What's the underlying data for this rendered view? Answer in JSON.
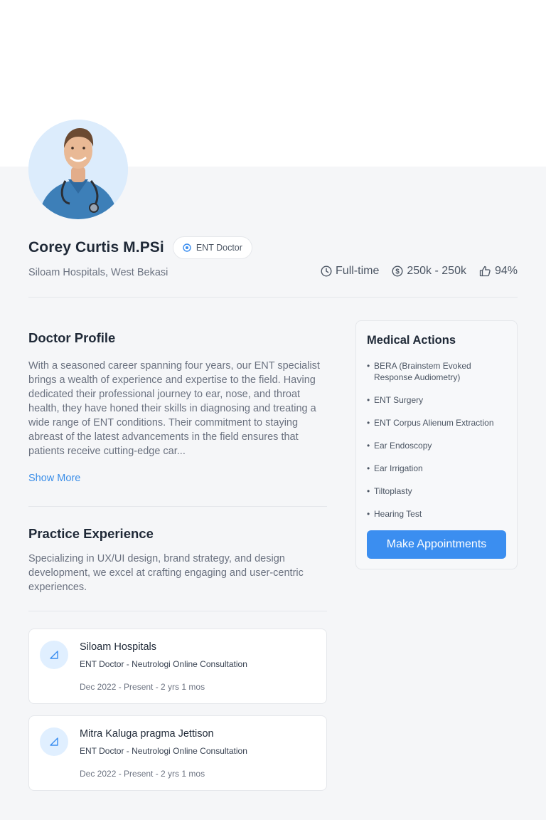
{
  "doctor": {
    "name": "Corey Curtis M.PSi",
    "badge": "ENT Doctor",
    "location": "Siloam Hospitals, West Bekasi"
  },
  "stats": {
    "employment": "Full-time",
    "fee": "250k - 250k",
    "rating": "94%"
  },
  "profile": {
    "title": "Doctor Profile",
    "text": "With a seasoned career spanning four years, our ENT specialist brings a wealth of experience and expertise to the field. Having dedicated their professional journey to ear, nose, and throat health, they have honed their skills in diagnosing and treating a wide range of ENT conditions. Their commitment to staying abreast of the latest advancements in the field ensures that patients receive cutting-edge car...",
    "show_more": "Show More"
  },
  "experience": {
    "title": "Practice Experience",
    "text": "Specializing in UX/UI design, brand strategy, and design development, we excel at crafting engaging and user-centric experiences.",
    "items": [
      {
        "title": "Siloam Hospitals",
        "role": "ENT Doctor - Neutrologi Online Consultation",
        "dates": "Dec 2022 - Present  - 2 yrs 1 mos"
      },
      {
        "title": "Mitra Kaluga pragma Jettison",
        "role": "ENT Doctor - Neutrologi Online Consultation",
        "dates": "Dec 2022 - Present  - 2 yrs 1 mos"
      }
    ]
  },
  "medical_actions": {
    "title": "Medical Actions",
    "items": [
      "BERA (Brainstem Evoked Response Audiometry)",
      "ENT Surgery",
      "ENT Corpus Alienum Extraction",
      "Ear Endoscopy",
      "Ear Irrigation",
      "Tiltoplasty",
      "Hearing Test"
    ],
    "button": "Make Appointments"
  },
  "colors": {
    "accent": "#3b8ef0",
    "link": "#3b8ee8",
    "page_bg": "#f5f6f8"
  },
  "icons": [
    "stethoscope-badge-icon",
    "clock-icon",
    "dollar-icon",
    "thumbs-up-icon",
    "experience-icon"
  ]
}
